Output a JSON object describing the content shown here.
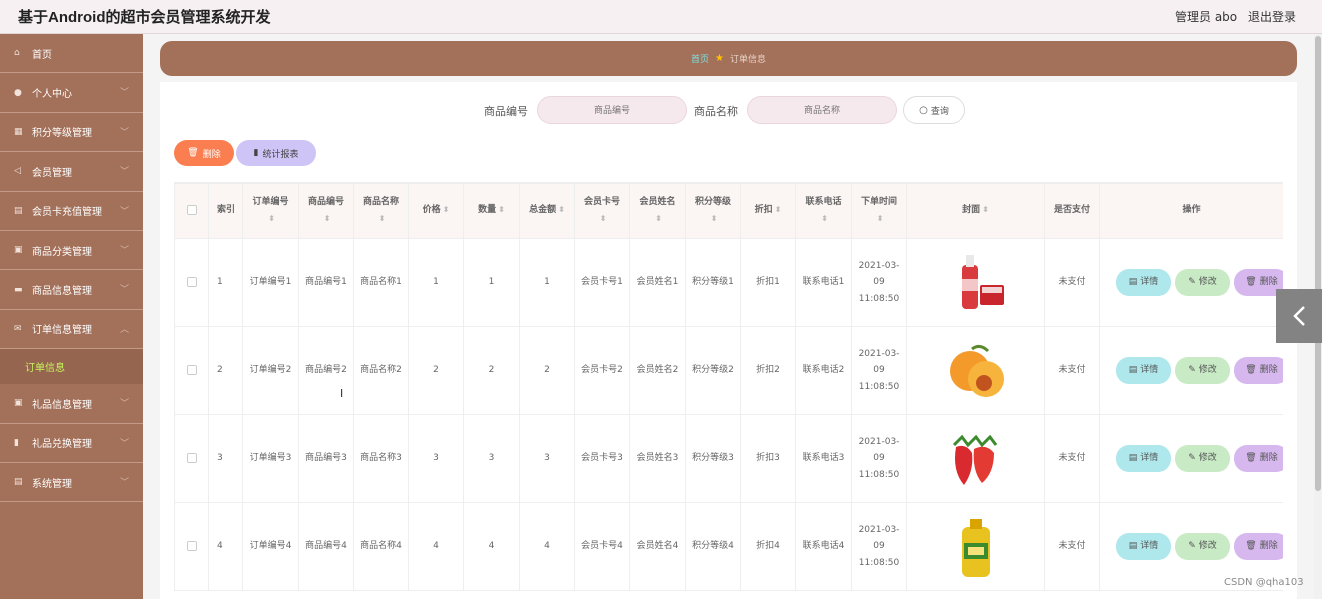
{
  "header": {
    "title": "基于Android的超市会员管理系统开发",
    "user": "管理员 abo",
    "logout": "退出登录"
  },
  "sidebar": {
    "items": [
      {
        "label": "首页",
        "icon": "home-icon",
        "glyph": "⌂",
        "arrow": false
      },
      {
        "label": "个人中心",
        "icon": "user-icon",
        "glyph": "●",
        "arrow": true
      },
      {
        "label": "积分等级管理",
        "icon": "grid-icon",
        "glyph": "▦",
        "arrow": true
      },
      {
        "label": "会员管理",
        "icon": "send-icon",
        "glyph": "◁",
        "arrow": true
      },
      {
        "label": "会员卡充值管理",
        "icon": "card-icon",
        "glyph": "▤",
        "arrow": true
      },
      {
        "label": "商品分类管理",
        "icon": "box-icon",
        "glyph": "▣",
        "arrow": true
      },
      {
        "label": "商品信息管理",
        "icon": "tag-icon",
        "glyph": "▬",
        "arrow": true
      },
      {
        "label": "订单信息管理",
        "icon": "mail-icon",
        "glyph": "✉",
        "arrow": true,
        "expanded": true
      },
      {
        "label": "礼品信息管理",
        "icon": "gift-icon",
        "glyph": "▣",
        "arrow": true
      },
      {
        "label": "礼品兑换管理",
        "icon": "chart-icon",
        "glyph": "▮",
        "arrow": true
      },
      {
        "label": "系统管理",
        "icon": "settings-icon",
        "glyph": "▤",
        "arrow": true
      }
    ],
    "submenu": {
      "label": "订单信息"
    }
  },
  "breadcrumb": {
    "home": "首页",
    "current": "订单信息"
  },
  "search": {
    "field1_label": "商品编号",
    "field1_placeholder": "商品编号",
    "field2_label": "商品名称",
    "field2_placeholder": "商品名称",
    "query": "查询"
  },
  "actions": {
    "delete": "删除",
    "stats": "统计报表"
  },
  "table": {
    "headers": [
      "索引",
      "订单编号",
      "商品编号",
      "商品名称",
      "价格",
      "数量",
      "总金额",
      "会员卡号",
      "会员姓名",
      "积分等级",
      "折扣",
      "联系电话",
      "下单时间",
      "封面",
      "是否支付",
      "操作"
    ],
    "rows": [
      {
        "index": "1",
        "order_no": "订单编号1",
        "goods_no": "商品编号1",
        "goods_name": "商品名称1",
        "price": "1",
        "qty": "1",
        "total": "1",
        "card_no": "会员卡号1",
        "member_name": "会员姓名1",
        "level": "积分等级1",
        "discount": "折扣1",
        "phone": "联系电话1",
        "time": "2021-03-09 11:08:50",
        "cover": "drink-bottle-image",
        "paid": "未支付"
      },
      {
        "index": "2",
        "order_no": "订单编号2",
        "goods_no": "商品编号2",
        "goods_name": "商品名称2",
        "price": "2",
        "qty": "2",
        "total": "2",
        "card_no": "会员卡号2",
        "member_name": "会员姓名2",
        "level": "积分等级2",
        "discount": "折扣2",
        "phone": "联系电话2",
        "time": "2021-03-09 11:08:50",
        "cover": "apricot-image",
        "paid": "未支付"
      },
      {
        "index": "3",
        "order_no": "订单编号3",
        "goods_no": "商品编号3",
        "goods_name": "商品名称3",
        "price": "3",
        "qty": "3",
        "total": "3",
        "card_no": "会员卡号3",
        "member_name": "会员姓名3",
        "level": "积分等级3",
        "discount": "折扣3",
        "phone": "联系电话3",
        "time": "2021-03-09 11:08:50",
        "cover": "strawberry-image",
        "paid": "未支付"
      },
      {
        "index": "4",
        "order_no": "订单编号4",
        "goods_no": "商品编号4",
        "goods_name": "商品名称4",
        "price": "4",
        "qty": "4",
        "total": "4",
        "card_no": "会员卡号4",
        "member_name": "会员姓名4",
        "level": "积分等级4",
        "discount": "折扣4",
        "phone": "联系电话4",
        "time": "2021-03-09 11:08:50",
        "cover": "cooking-oil-image",
        "paid": "未支付"
      }
    ],
    "row_actions": {
      "detail": "详情",
      "edit": "修改",
      "delete": "删除"
    }
  },
  "watermark": "CSDN @qha103",
  "colors": {
    "sidebar": "#a3705a",
    "accent_delete": "#fa7e4f",
    "accent_stats": "#cec4f6",
    "submenu_active": "#c7f35b"
  }
}
